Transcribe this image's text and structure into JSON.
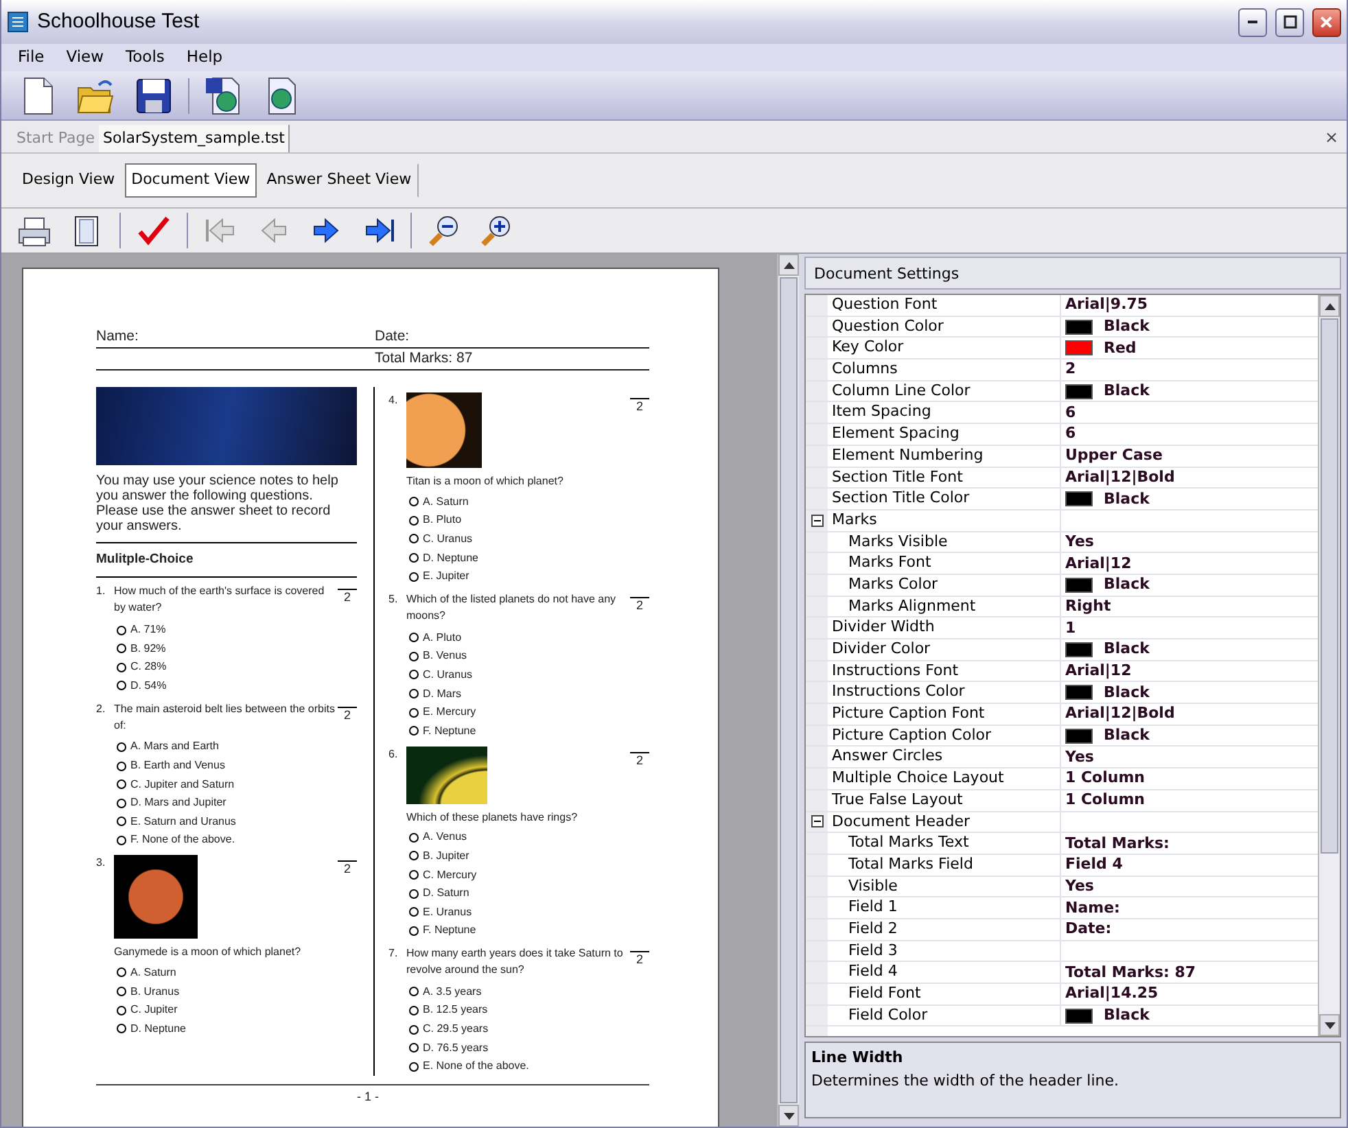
{
  "window": {
    "title": "Schoolhouse Test"
  },
  "menu": [
    "File",
    "View",
    "Tools",
    "Help"
  ],
  "toolbar": [
    {
      "kind": "new"
    },
    {
      "kind": "open"
    },
    {
      "kind": "save"
    },
    {
      "kind": "sep"
    },
    {
      "kind": "export"
    },
    {
      "kind": "web"
    }
  ],
  "doc_tabs": [
    {
      "label": "Start Page",
      "selected": false
    },
    {
      "label": "SolarSystem_sample.tst",
      "selected": true
    }
  ],
  "doc_close": "×",
  "view_tabs": [
    {
      "label": "Design View",
      "selected": false
    },
    {
      "label": "Document View",
      "selected": true
    },
    {
      "label": "Answer Sheet View",
      "selected": false
    }
  ],
  "doc_toolbar": [
    {
      "kind": "print"
    },
    {
      "kind": "page"
    },
    {
      "kind": "sep"
    },
    {
      "kind": "check"
    },
    {
      "kind": "sep"
    },
    {
      "kind": "first",
      "disabled": true
    },
    {
      "kind": "prev",
      "disabled": true
    },
    {
      "kind": "next",
      "disabled": false
    },
    {
      "kind": "last",
      "disabled": false
    },
    {
      "kind": "sep"
    },
    {
      "kind": "zoomout"
    },
    {
      "kind": "zoomin"
    }
  ],
  "document": {
    "header": {
      "field_1": "Name:",
      "field_2": "Date:",
      "field_4": "Total Marks: 87"
    },
    "columns": [
      [
        {
          "kind": "banner"
        },
        {
          "kind": "instructions",
          "text": "You may use your science notes to help you answer the following questions. Please use the answer sheet to record your answers."
        },
        {
          "kind": "section",
          "text": "Mulitple-Choice"
        },
        {
          "kind": "question",
          "number": "1.",
          "text": "How much of the earth's surface is covered by water?",
          "marks": "2",
          "options": [
            "A. 71%",
            "B. 92%",
            "C. 28%",
            "D. 54%"
          ]
        },
        {
          "kind": "question",
          "number": "2.",
          "text": "The main asteroid belt lies between the orbits of:",
          "marks": "2",
          "options": [
            "A. Mars and Earth",
            "B. Earth and Venus",
            "C. Jupiter and Saturn",
            "D. Mars and Jupiter",
            "E. Saturn and Uranus",
            "F. None of the above."
          ]
        },
        {
          "kind": "picture_question",
          "number": "3.",
          "text": "Ganymede is a moon of which planet?",
          "marks": "2",
          "options": [
            "A. Saturn",
            "B. Uranus",
            "C. Jupiter",
            "D. Neptune"
          ]
        }
      ],
      [
        {
          "kind": "picture_question",
          "number": "4.",
          "text": "Titan is a moon of which planet?",
          "marks": "2",
          "options": [
            "A. Saturn",
            "B. Pluto",
            "C. Uranus",
            "D. Neptune",
            "E. Jupiter"
          ]
        },
        {
          "kind": "question",
          "number": "5.",
          "text": "Which of the listed planets do not have any moons?",
          "marks": "2",
          "options": [
            "A. Pluto",
            "B. Venus",
            "C. Uranus",
            "D. Mars",
            "E. Mercury",
            "F. Neptune"
          ]
        },
        {
          "kind": "picture_question",
          "number": "6.",
          "text": "Which of these planets have rings?",
          "marks": "2",
          "options": [
            "A. Venus",
            "B. Jupiter",
            "C. Mercury",
            "D. Saturn",
            "E. Uranus",
            "F. Neptune"
          ]
        },
        {
          "kind": "question",
          "number": "7.",
          "text": "How many earth years does it take Saturn to revolve around the sun?",
          "marks": "2",
          "options": [
            "A. 3.5 years",
            "B. 12.5 years",
            "C. 29.5 years",
            "D. 76.5 years",
            "E. None of the above."
          ]
        }
      ]
    ],
    "page_number": "- 1 -"
  },
  "settings": {
    "title": "Document Settings",
    "properties": [
      {
        "kind": "text",
        "name": "Question Font",
        "value": "Arial|9.75"
      },
      {
        "kind": "color",
        "name": "Question Color",
        "value": "Black",
        "color": "#000000"
      },
      {
        "kind": "color",
        "name": "Key Color",
        "value": "Red",
        "color": "#ff0000"
      },
      {
        "kind": "text",
        "name": "Columns",
        "value": "2"
      },
      {
        "kind": "color",
        "name": "Column Line Color",
        "value": "Black",
        "color": "#000000"
      },
      {
        "kind": "text",
        "name": "Item Spacing",
        "value": "6"
      },
      {
        "kind": "text",
        "name": "Element Spacing",
        "value": "6"
      },
      {
        "kind": "text",
        "name": "Element Numbering",
        "value": "Upper Case"
      },
      {
        "kind": "text",
        "name": "Section Title Font",
        "value": "Arial|12|Bold"
      },
      {
        "kind": "color",
        "name": "Section Title Color",
        "value": "Black",
        "color": "#000000"
      },
      {
        "kind": "group",
        "name": "Marks",
        "expanded": true,
        "children": [
          {
            "kind": "text",
            "name": "Marks Visible",
            "value": "Yes"
          },
          {
            "kind": "text",
            "name": "Marks Font",
            "value": "Arial|12"
          },
          {
            "kind": "color",
            "name": "Marks Color",
            "value": "Black",
            "color": "#000000"
          },
          {
            "kind": "text",
            "name": "Marks Alignment",
            "value": "Right"
          }
        ]
      },
      {
        "kind": "text",
        "name": "Divider Width",
        "value": "1"
      },
      {
        "kind": "color",
        "name": "Divider Color",
        "value": "Black",
        "color": "#000000"
      },
      {
        "kind": "text",
        "name": "Instructions Font",
        "value": "Arial|12"
      },
      {
        "kind": "color",
        "name": "Instructions Color",
        "value": "Black",
        "color": "#000000"
      },
      {
        "kind": "text",
        "name": "Picture Caption Font",
        "value": "Arial|12|Bold"
      },
      {
        "kind": "color",
        "name": "Picture Caption Color",
        "value": "Black",
        "color": "#000000"
      },
      {
        "kind": "text",
        "name": "Answer Circles",
        "value": "Yes"
      },
      {
        "kind": "text",
        "name": "Multiple Choice Layout",
        "value": "1 Column"
      },
      {
        "kind": "text",
        "name": "True False Layout",
        "value": "1 Column"
      },
      {
        "kind": "group",
        "name": "Document Header",
        "expanded": true,
        "children": [
          {
            "kind": "text",
            "name": "Total Marks Text",
            "value": "Total Marks:"
          },
          {
            "kind": "text",
            "name": "Total Marks Field",
            "value": "Field 4"
          },
          {
            "kind": "text",
            "name": "Visible",
            "value": "Yes"
          },
          {
            "kind": "text",
            "name": "Field 1",
            "value": "Name:"
          },
          {
            "kind": "text",
            "name": "Field 2",
            "value": "Date:"
          },
          {
            "kind": "text",
            "name": "Field 3"
          },
          {
            "kind": "text",
            "name": "Field 4",
            "value": "Total Marks: 87"
          },
          {
            "kind": "text",
            "name": "Field Font",
            "value": "Arial|14.25"
          },
          {
            "kind": "color",
            "name": "Field Color",
            "value": "Black",
            "color": "#000000"
          }
        ]
      }
    ],
    "description": {
      "title": "Line Width",
      "text": "Determines the width of the header line."
    }
  }
}
